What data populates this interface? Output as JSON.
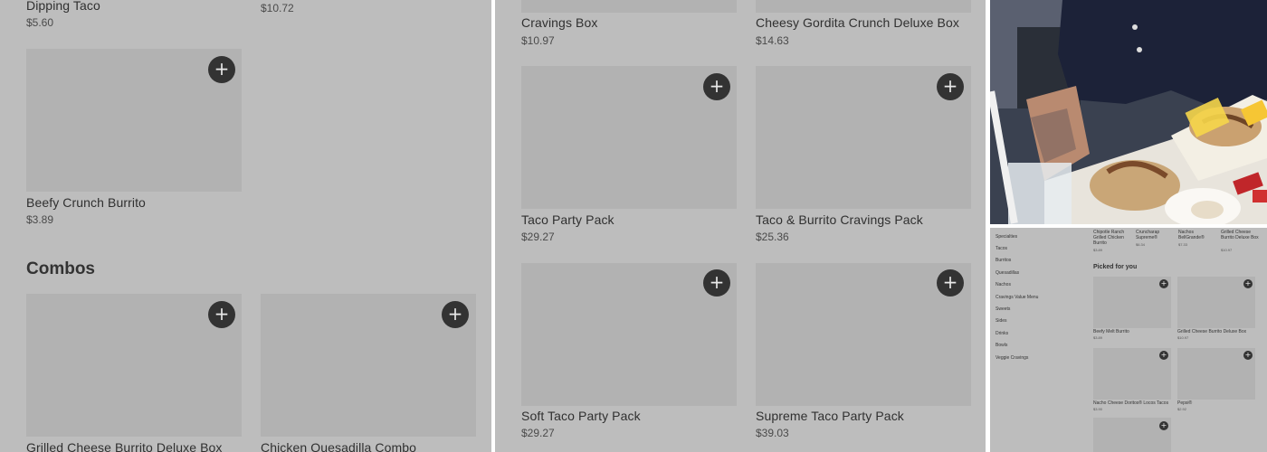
{
  "panel1": {
    "top_items": [
      {
        "name": "Dipping Taco",
        "price": "$5.60"
      },
      {
        "name": "",
        "price": "$10.72"
      }
    ],
    "item_beefy": {
      "name": "Beefy Crunch Burrito",
      "price": "$3.89"
    },
    "section_title": "Combos",
    "combos": [
      {
        "name": "Grilled Cheese Burrito Deluxe Box"
      },
      {
        "name": "Chicken Quesadilla Combo"
      }
    ],
    "add_symbol": "+"
  },
  "panel2": {
    "row0": [
      {
        "name": "Cravings Box",
        "price": "$10.97"
      },
      {
        "name": "Cheesy Gordita Crunch Deluxe Box",
        "price": "$14.63"
      }
    ],
    "row1": [
      {
        "name": "Taco Party Pack",
        "price": "$29.27"
      },
      {
        "name": "Taco & Burrito Cravings Pack",
        "price": "$25.36"
      }
    ],
    "row2": [
      {
        "name": "Soft Taco Party Pack",
        "price": "$29.27"
      },
      {
        "name": "Supreme Taco Party Pack",
        "price": "$39.03"
      }
    ]
  },
  "panel4": {
    "sidebar": [
      "Specialties",
      "Tacos",
      "Burritos",
      "Quesadillas",
      "Nachos",
      "Cravings Value Menu",
      "Sweets",
      "Sides",
      "Drinks",
      "Bowls",
      "Veggie Cravings"
    ],
    "top_row": [
      {
        "name": "Chipotle Ranch Grilled Chicken Burrito",
        "price": "$3.89"
      },
      {
        "name": "Cruncharap Supreme®",
        "price": "$6.34"
      },
      {
        "name": "Nachos BellGrande®",
        "price": "$7.33"
      },
      {
        "name": "Grilled Cheese Burrito Deluxe Box",
        "price": "$10.97"
      }
    ],
    "picked_title": "Picked for you",
    "picked": [
      {
        "name": "Beefy Melt Burrito",
        "price": "$3.89"
      },
      {
        "name": "Grilled Cheese Burrito Deluxe Box",
        "price": "$10.97"
      },
      {
        "name": "Nacho Cheese Doritos® Locos Tacos",
        "price": "$3.90"
      },
      {
        "name": "Pepsi®",
        "price": "$2.92"
      }
    ]
  },
  "colors": {
    "panel_bg": "#bdbdbd",
    "thumb": "#b2b2b2",
    "add_button": "#333333"
  }
}
